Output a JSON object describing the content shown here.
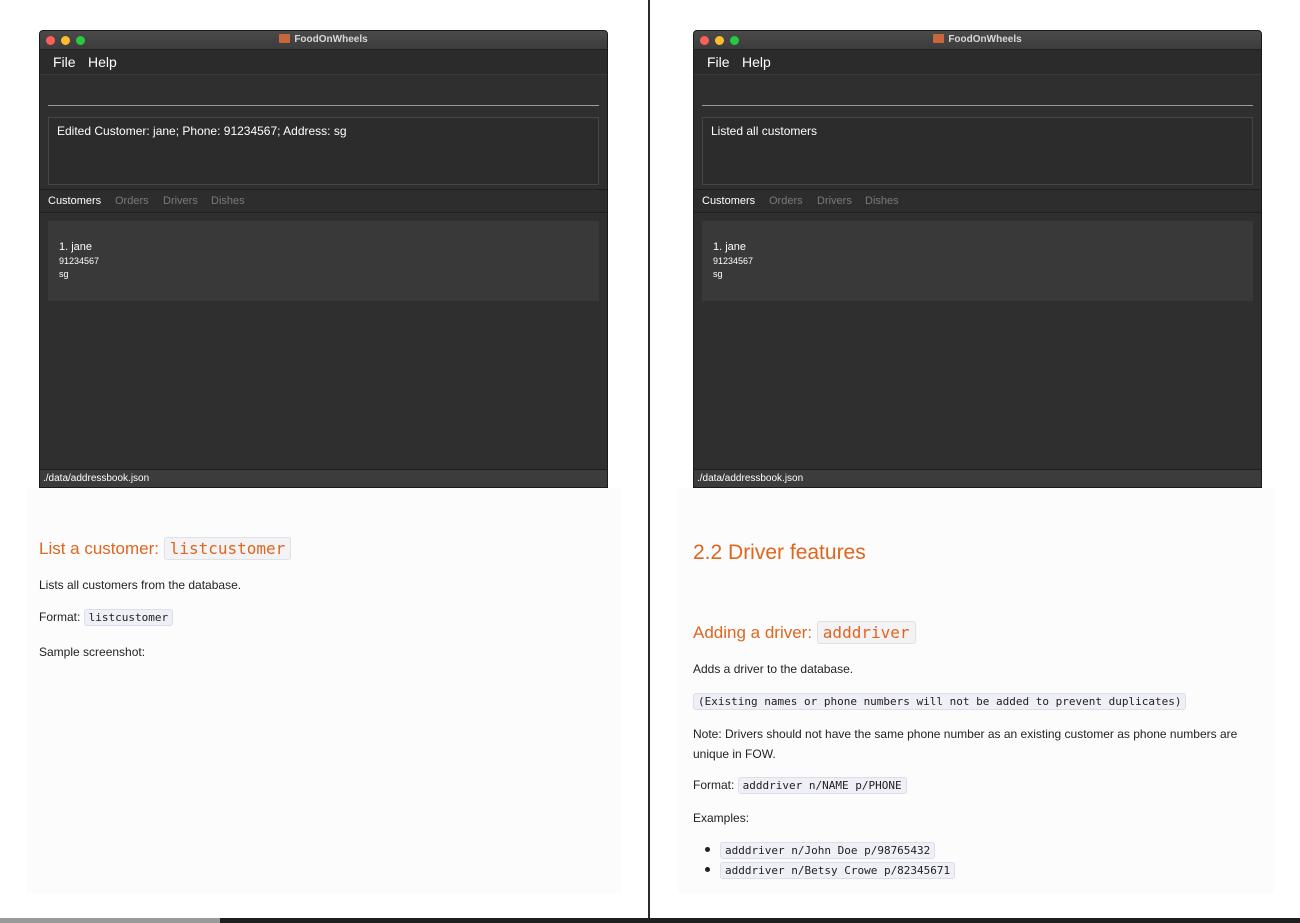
{
  "app": {
    "title": "FoodOnWheels",
    "menu": [
      "File",
      "Help"
    ],
    "tabs": [
      "Customers",
      "Orders",
      "Drivers",
      "Dishes"
    ],
    "status": "./data/addressbook.json",
    "customer": {
      "index_name": "1.  jane",
      "phone": "91234567",
      "address": "sg"
    }
  },
  "left": {
    "result": "Edited Customer: jane; Phone: 91234567; Address: sg",
    "heading_text": "List a customer: ",
    "heading_code": "listcustomer",
    "desc": "Lists all customers from the database.",
    "format_label": "Format: ",
    "format_code": "listcustomer",
    "sample": "Sample screenshot:"
  },
  "right": {
    "result": "Listed all customers",
    "section": "2.2 Driver features",
    "heading_text": "Adding a driver: ",
    "heading_code": "adddriver",
    "desc": "Adds a driver to the database.",
    "dup_note": "(Existing names or phone numbers will not be added to prevent duplicates)",
    "note": "Note: Drivers should not have the same phone number as an existing customer as phone numbers are unique in FOW.",
    "format_label": "Format: ",
    "format_code": "adddriver n/NAME p/PHONE",
    "examples_label": "Examples:",
    "examples": [
      "adddriver n/John Doe p/98765432",
      "adddriver n/Betsy Crowe p/82345671"
    ]
  },
  "colors": {
    "heading": "#e0651d",
    "window_bg": "#2f2f2f"
  }
}
